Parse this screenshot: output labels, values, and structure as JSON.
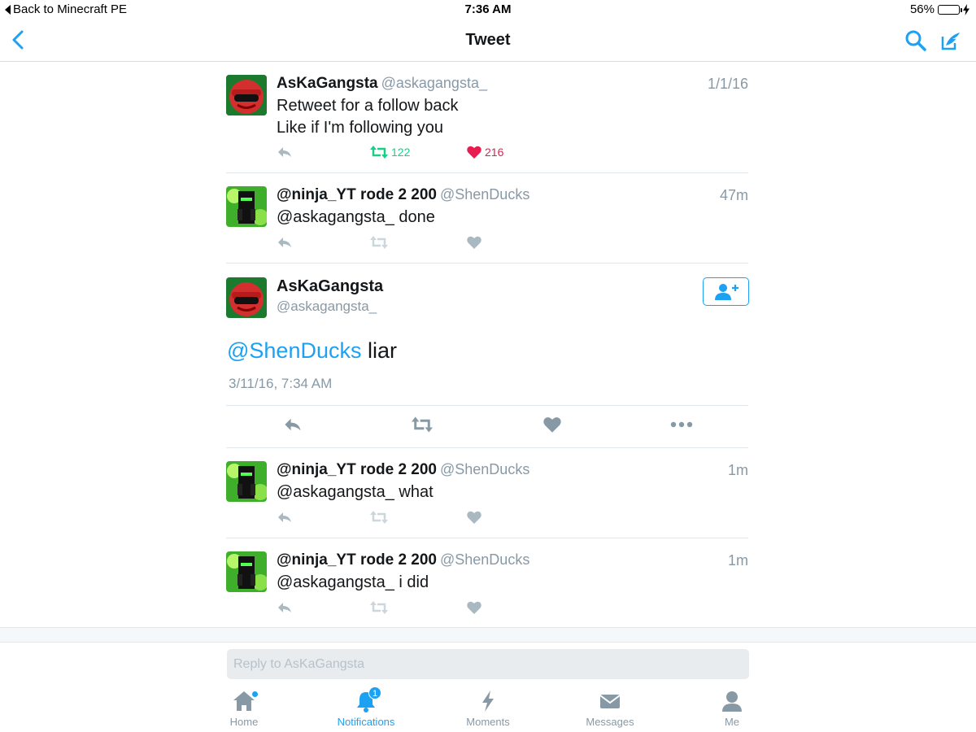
{
  "status_bar": {
    "back_app": "Back to Minecraft PE",
    "time": "7:36 AM",
    "battery": "56%",
    "battery_level": 0.56
  },
  "nav": {
    "title": "Tweet"
  },
  "tweets": [
    {
      "name": "AsKaGangsta",
      "handle": "@askagangsta_",
      "time": "1/1/16",
      "line1": "Retweet for a follow back",
      "line2": "Like if I'm following you",
      "retweets": "122",
      "likes": "216"
    },
    {
      "name": "@ninja_YT rode 2 200",
      "handle": "@ShenDucks",
      "time": "47m",
      "line1": "@askagangsta_ done"
    },
    {
      "name": "@ninja_YT rode 2 200",
      "handle": "@ShenDucks",
      "time": "1m",
      "line1": "@askagangsta_ what"
    },
    {
      "name": "@ninja_YT rode 2 200",
      "handle": "@ShenDucks",
      "time": "1m",
      "line1": "@askagangsta_ i did"
    }
  ],
  "main_tweet": {
    "name": "AsKaGangsta",
    "handle": "@askagangsta_",
    "mention": "@ShenDucks",
    "text": " liar",
    "date": "3/11/16, 7:34 AM"
  },
  "reply": {
    "placeholder": "Reply to AsKaGangsta"
  },
  "tabs": {
    "home": "Home",
    "notifications": "Notifications",
    "notifications_badge": "1",
    "moments": "Moments",
    "messages": "Messages",
    "me": "Me"
  },
  "colors": {
    "accent": "#1da1f2",
    "retweet": "#19cf86",
    "like": "#e81c4f",
    "muted": "#aab8c2"
  }
}
